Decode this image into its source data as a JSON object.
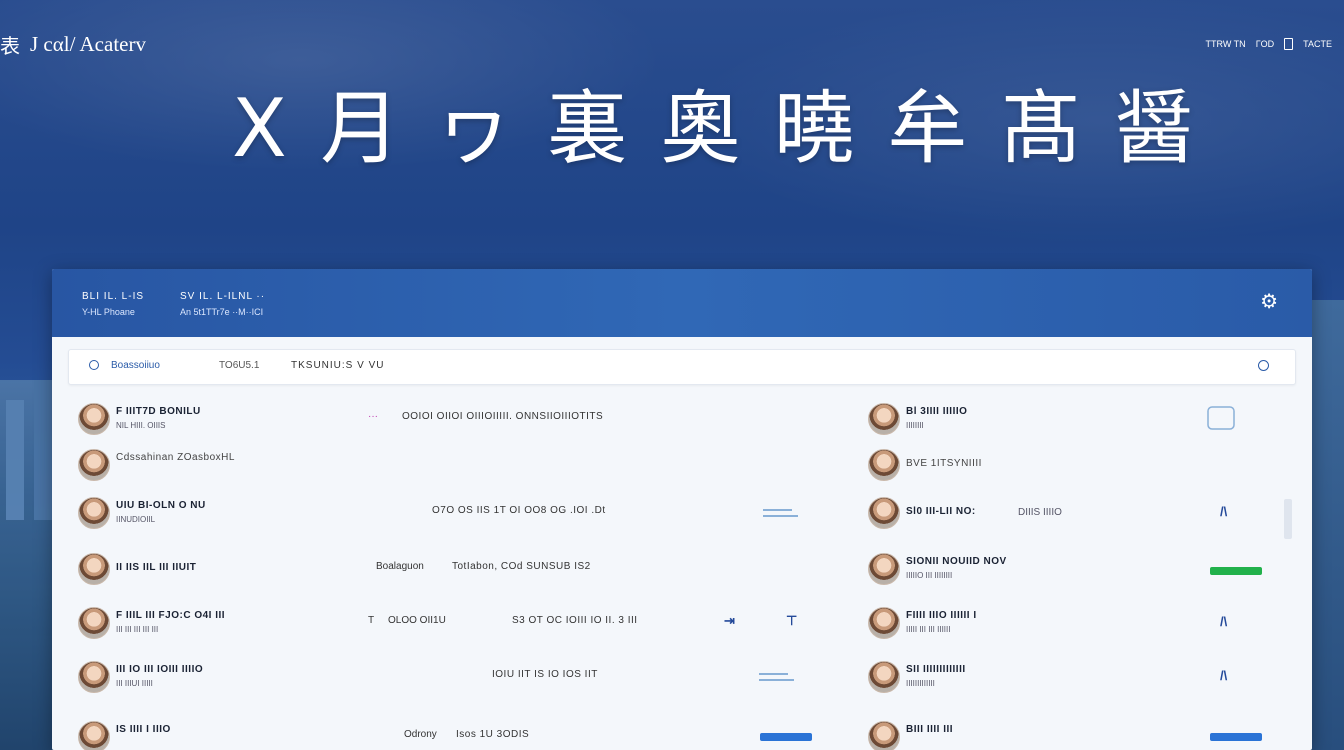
{
  "header": {
    "brand_mark": "表",
    "brand_name": "J cαl/ Acaterv",
    "links": [
      "TTRW TN",
      "ΓOD",
      "TACTE"
    ]
  },
  "hero": {
    "title": "Ⅹ 月 ヮ 裏 奧 曉 牟 髙 醤"
  },
  "panel": {
    "title": "BLI IL. L-IS",
    "title2": "SV IL. L-ILNL ··",
    "subtitle": "Y-HL Phoane",
    "subtitle2": "An 5t1TTr7e ··M··ICI",
    "settings_icon": "gear-icon"
  },
  "search": {
    "label": "Boassoiiuo",
    "filter": "TO6U5.1",
    "filter2": "TKSUNIU:S V VU"
  },
  "left_rows": [
    {
      "name": "F IIIT7D BONILU",
      "sub": "NIL HIII. OIIIS",
      "mid": "",
      "tag": "···",
      "mid2": "OOIOI OIIOI OIIIOIIIII. ONNSIIOIIIOTITS"
    },
    {
      "name": "Cdssahinan ZOasboxHL",
      "sub": "",
      "mid": "",
      "tag": "",
      "mid2": ""
    },
    {
      "name": "UIU BI-OLN O NU",
      "sub": "IINUDIOIIL",
      "mid": "",
      "tag": "",
      "mid2": "O7O OS IIS 1T OI OO8 OG .IOI .Dt"
    },
    {
      "name": "II IIS IIL III IIUIT",
      "sub": "",
      "mid": "",
      "tag": "Boalaguon",
      "mid2": "TotIabon, COd SUNSUB IS2"
    },
    {
      "name": "F IIIL III FJO:C O4I III",
      "sub": "III III III III III",
      "mid": "T",
      "tag": "OLOO OII1U",
      "mid2": "S3 OT OC IOIII IO II. 3 III"
    },
    {
      "name": "III IO III IOIII IIIIO",
      "sub": "III IIIUI IIIII",
      "mid": "",
      "tag": "",
      "mid2": "IOIU IIT IS IO IOS IIT"
    },
    {
      "name": "IS IIII I IIIO",
      "sub": "",
      "mid": "",
      "tag": "Odrony",
      "mid2": "Isos 1U 3ODIS"
    }
  ],
  "right_rows": [
    {
      "name": "Bl 3IIII IIIIIO",
      "sub": "IIIIIIII"
    },
    {
      "name": "BVE 1ITSYNIIII",
      "sub": ""
    },
    {
      "name": "Sl0 III-LII NO:",
      "sub": "DIIIS IIIIO"
    },
    {
      "name": "SIONII NOUIID NOV",
      "sub": "IIIIIO III IIIIIIII"
    },
    {
      "name": "FIIII IIIO IIIIII I",
      "sub": "IIIII III III IIIIII"
    },
    {
      "name": "SII IIIIIIIIIIIII",
      "sub": "IIIIIIIIIIIII"
    },
    {
      "name": "BIII IIII III",
      "sub": ""
    }
  ],
  "colors": {
    "accent": "#2a5ba8",
    "status_green": "#21b14b",
    "status_blue": "#2a73d6"
  }
}
